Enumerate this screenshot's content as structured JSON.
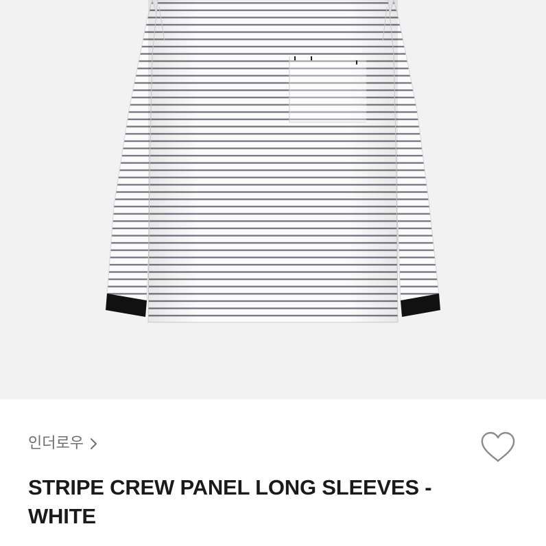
{
  "product": {
    "image_alt": "Striped long sleeve shirt with black cuffs",
    "brand": "인더로우",
    "title": "STRIPE CREW PANEL LONG SLEEVES - WHITE"
  },
  "icons": {
    "brand_chevron": "chevron-right-icon",
    "wishlist": "heart-outline-icon"
  },
  "colors": {
    "image_background": "#f2f2f2",
    "stripe_dark": "#5a5e6b",
    "cuff": "#111111",
    "title_text": "#1a1a1a",
    "brand_text": "#6e6e6e",
    "heart_stroke": "#8a8a8a"
  }
}
